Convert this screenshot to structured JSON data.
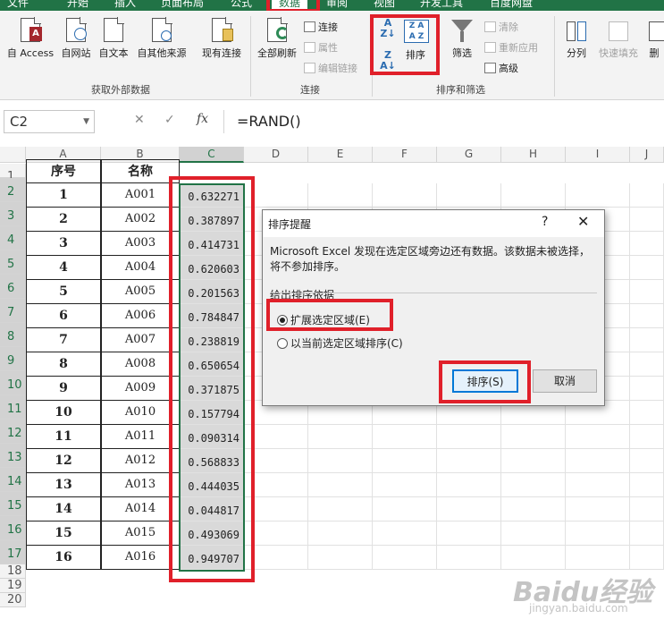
{
  "tabs": [
    "文件",
    "开始",
    "插入",
    "页面布局",
    "公式",
    "数据",
    "审阅",
    "视图",
    "开发工具",
    "百度网盘"
  ],
  "active_tab": "数据",
  "ribbon": {
    "get_external": {
      "access": "自 Access",
      "web": "自网站",
      "text": "自文本",
      "other": "自其他来源",
      "existing": "现有连接",
      "label": "获取外部数据"
    },
    "connections": {
      "refresh_all": "全部刷新",
      "connections": "连接",
      "properties": "属性",
      "edit_links": "编辑链接",
      "label": "连接"
    },
    "sort_filter": {
      "sort": "排序",
      "filter": "筛选",
      "clear": "清除",
      "reapply": "重新应用",
      "advanced": "高级",
      "label": "排序和筛选"
    },
    "data_tools": {
      "text_to_columns": "分列",
      "flash_fill": "快速填充",
      "remove_dup": "删"
    }
  },
  "formula_bar": {
    "name_box": "C2",
    "fx": "fx",
    "formula": "=RAND()"
  },
  "sheet": {
    "columns": [
      "A",
      "B",
      "C",
      "D",
      "E",
      "F",
      "G",
      "H",
      "I",
      "J"
    ],
    "rows": [
      "1",
      "2",
      "3",
      "4",
      "5",
      "6",
      "7",
      "8",
      "9",
      "10",
      "11",
      "12",
      "13",
      "14",
      "15",
      "16",
      "17",
      "18",
      "19",
      "20"
    ],
    "header": {
      "a": "序号",
      "b": "名称"
    },
    "data": [
      {
        "a": "1",
        "b": "A001",
        "c": "0.632271"
      },
      {
        "a": "2",
        "b": "A002",
        "c": "0.387897"
      },
      {
        "a": "3",
        "b": "A003",
        "c": "0.414731"
      },
      {
        "a": "4",
        "b": "A004",
        "c": "0.620603"
      },
      {
        "a": "5",
        "b": "A005",
        "c": "0.201563"
      },
      {
        "a": "6",
        "b": "A006",
        "c": "0.784847"
      },
      {
        "a": "7",
        "b": "A007",
        "c": "0.238819"
      },
      {
        "a": "8",
        "b": "A008",
        "c": "0.650654"
      },
      {
        "a": "9",
        "b": "A009",
        "c": "0.371875"
      },
      {
        "a": "10",
        "b": "A010",
        "c": "0.157794"
      },
      {
        "a": "11",
        "b": "A011",
        "c": "0.090314"
      },
      {
        "a": "12",
        "b": "A012",
        "c": "0.568833"
      },
      {
        "a": "13",
        "b": "A013",
        "c": "0.444035"
      },
      {
        "a": "14",
        "b": "A014",
        "c": "0.044817"
      },
      {
        "a": "15",
        "b": "A015",
        "c": "0.493069"
      },
      {
        "a": "16",
        "b": "A016",
        "c": "0.949707"
      }
    ]
  },
  "dialog": {
    "title": "排序提醒",
    "help": "?",
    "close": "✕",
    "message": "Microsoft Excel 发现在选定区域旁边还有数据。该数据未被选择，将不参加排序。",
    "group_label": "给出排序依据",
    "option_expand": "扩展选定区域(E)",
    "option_current": "以当前选定区域排序(C)",
    "sort_button": "排序(S)",
    "cancel_button": "取消"
  },
  "watermark": {
    "brand": "Baidu经验",
    "url": "jingyan.baidu.com"
  },
  "colors": {
    "excel_green": "#217346",
    "highlight_red": "#e0202a",
    "dialog_blue": "#0078d7"
  }
}
